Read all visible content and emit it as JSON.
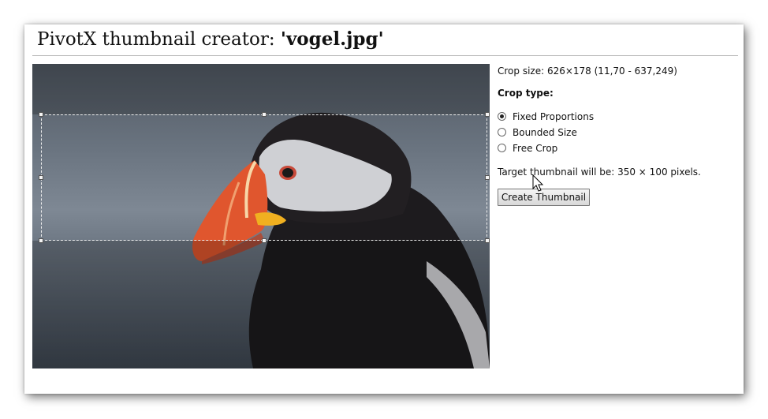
{
  "window": {
    "title_prefix": "PivotX thumbnail creator: ",
    "title_filename": "'vogel.jpg'"
  },
  "panel": {
    "crop_size": "Crop size: 626×178 (11,70 - 637,249)",
    "crop_type_label": "Crop type:",
    "options": [
      {
        "label": "Fixed Proportions",
        "checked": true
      },
      {
        "label": "Bounded Size",
        "checked": false
      },
      {
        "label": "Free Crop",
        "checked": false
      }
    ],
    "target_text": "Target thumbnail will be: 350 × 100 pixels.",
    "create_button": "Create Thumbnail"
  },
  "image": {
    "subject": "puffin photograph"
  },
  "icons": {
    "cursor": "arrow-cursor-icon"
  }
}
